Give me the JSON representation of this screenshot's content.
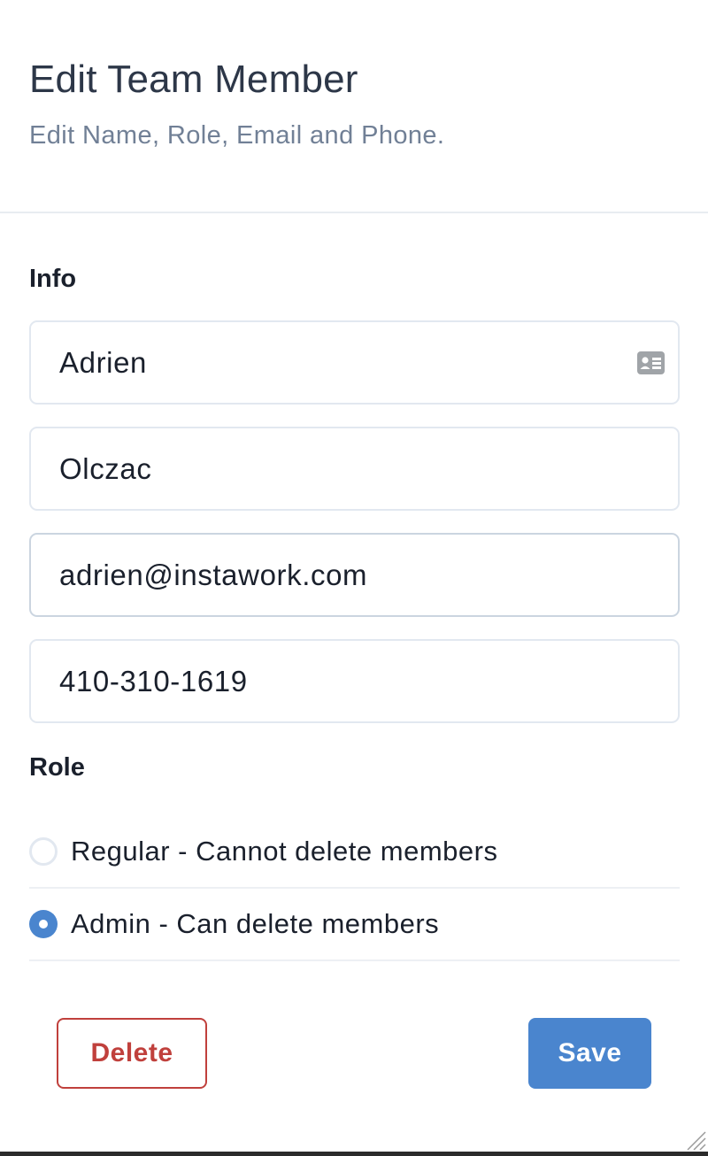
{
  "header": {
    "title": "Edit Team Member",
    "subtitle": "Edit Name, Role, Email and Phone."
  },
  "info": {
    "label": "Info",
    "first_name": "Adrien",
    "last_name": "Olczac",
    "email": "adrien@instawork.com",
    "phone": "410-310-1619",
    "contact_icon": "contact-card-icon"
  },
  "role": {
    "label": "Role",
    "options": [
      {
        "label": "Regular - Cannot delete members",
        "checked": false
      },
      {
        "label": "Admin - Can delete members",
        "checked": true
      }
    ]
  },
  "actions": {
    "delete_label": "Delete",
    "save_label": "Save"
  },
  "colors": {
    "primary": "#4a85ce",
    "danger": "#c0403c",
    "title": "#2d3748",
    "muted": "#718096"
  }
}
